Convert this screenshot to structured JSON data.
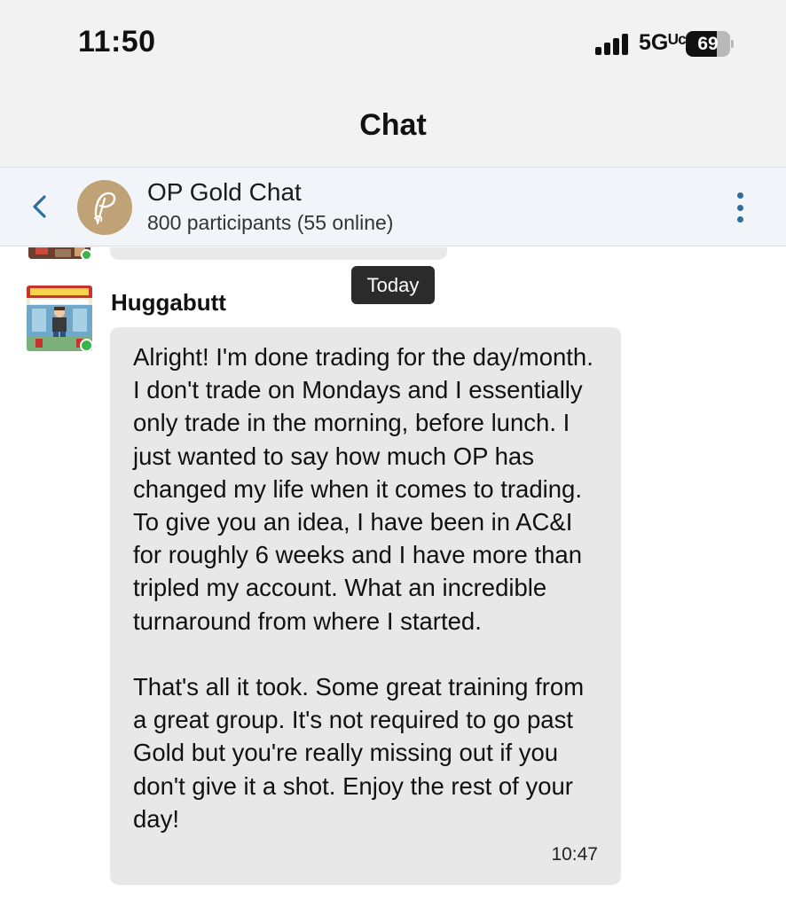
{
  "status_bar": {
    "time": "11:50",
    "network": "5Gᵁᶜ",
    "battery": "69",
    "battery_level": 0.69,
    "signal_bars": 4
  },
  "nav": {
    "title": "Chat"
  },
  "chat": {
    "name": "OP Gold Chat",
    "participants": "800 participants (55 online)",
    "avatar_icon": "op-logo-icon",
    "accent": "#2a6f9e",
    "avatar_color": "#bfa275"
  },
  "date_badge": "Today",
  "message": {
    "sender": "Huggabutt",
    "avatar_icon": "bobs-burgers-avatar",
    "text": "Alright! I'm done trading for the day/month. I don't trade on Mondays and I essentially only trade in the morning, before lunch. I just wanted to say how much OP has changed my life when it comes to trading. To give you an idea, I have been in AC&I for roughly 6 weeks and I have more than tripled my account. What an incredible turnaround from where I started.\n\nThat's all it took. Some great training from a great group. It's not required to go past Gold but you're really missing out if you don't give it a shot. Enjoy the rest of your day!",
    "time": "10:47",
    "bubble_color": "#e8e8e8",
    "online_color": "#39b54a"
  }
}
